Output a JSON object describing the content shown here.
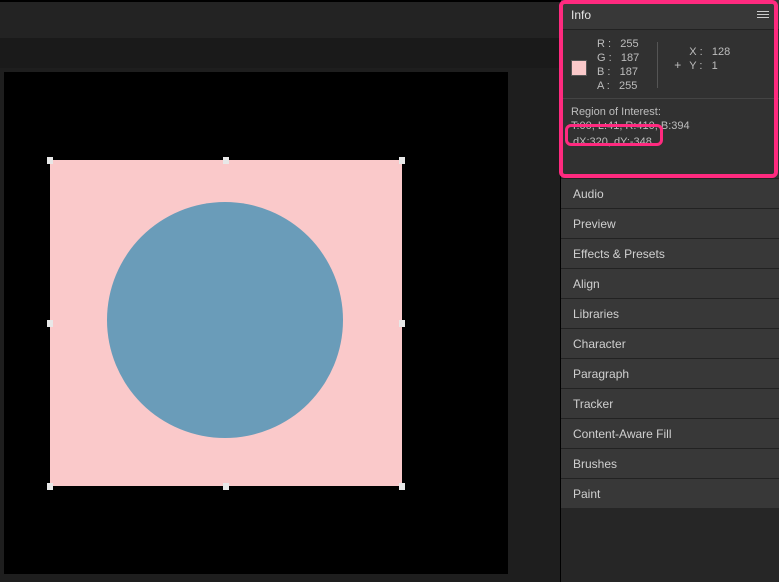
{
  "info": {
    "title": "Info",
    "swatch_color": "#fac9ca",
    "rgba": {
      "r": "R :   255",
      "g": "G :   187",
      "b": "B :   187",
      "a": "A :   255"
    },
    "xy": {
      "x": "X :   128",
      "y": "Y :   1"
    },
    "roi_label": "Region of Interest:",
    "roi_line2": "T:00, L:41, R:410, B:394",
    "dxy": "dX:320, dY:-348"
  },
  "panels": [
    {
      "label": "Audio"
    },
    {
      "label": "Preview"
    },
    {
      "label": "Effects & Presets"
    },
    {
      "label": "Align"
    },
    {
      "label": "Libraries"
    },
    {
      "label": "Character"
    },
    {
      "label": "Paragraph"
    },
    {
      "label": "Tracker"
    },
    {
      "label": "Content-Aware Fill"
    },
    {
      "label": "Brushes"
    },
    {
      "label": "Paint"
    }
  ],
  "colors": {
    "pink_layer": "#fac9ca",
    "circle": "#6a9cb9",
    "highlight": "#ff2a7f"
  }
}
